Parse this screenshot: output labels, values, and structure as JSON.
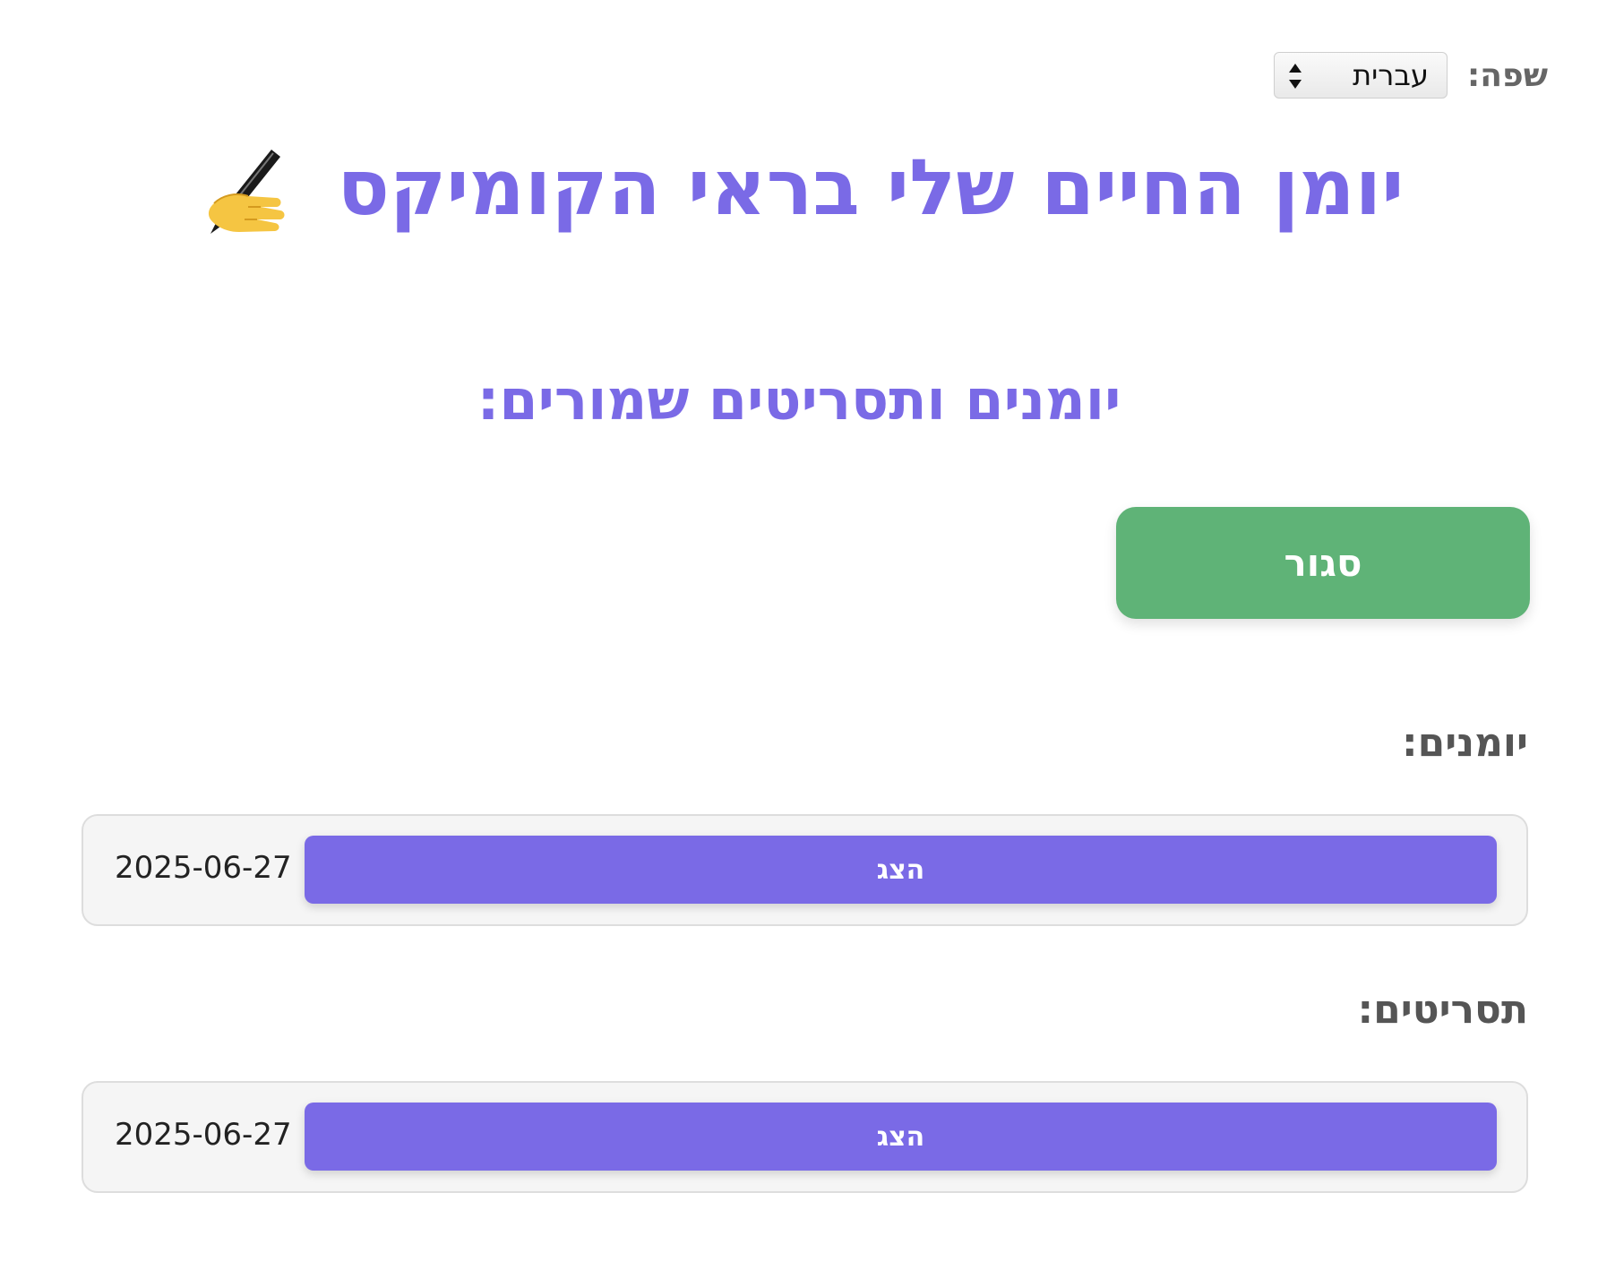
{
  "language": {
    "label": "שפה:",
    "selected": "עברית"
  },
  "header": {
    "title": "יומן החיים שלי בראי הקומיקס",
    "title_icon": "writing-hand-icon"
  },
  "saved_section": {
    "title": "יומנים ותסריטים שמורים:",
    "close_label": "סגור"
  },
  "diaries": {
    "heading": "יומנים:",
    "items": [
      {
        "date": "2025-06-27",
        "show_label": "הצג"
      }
    ]
  },
  "scripts": {
    "heading": "תסריטים:",
    "items": [
      {
        "date": "2025-06-27",
        "show_label": "הצג"
      }
    ]
  },
  "colors": {
    "accent": "#7a6ae6",
    "close_button": "#5fb377",
    "heading_gray": "#555555"
  }
}
